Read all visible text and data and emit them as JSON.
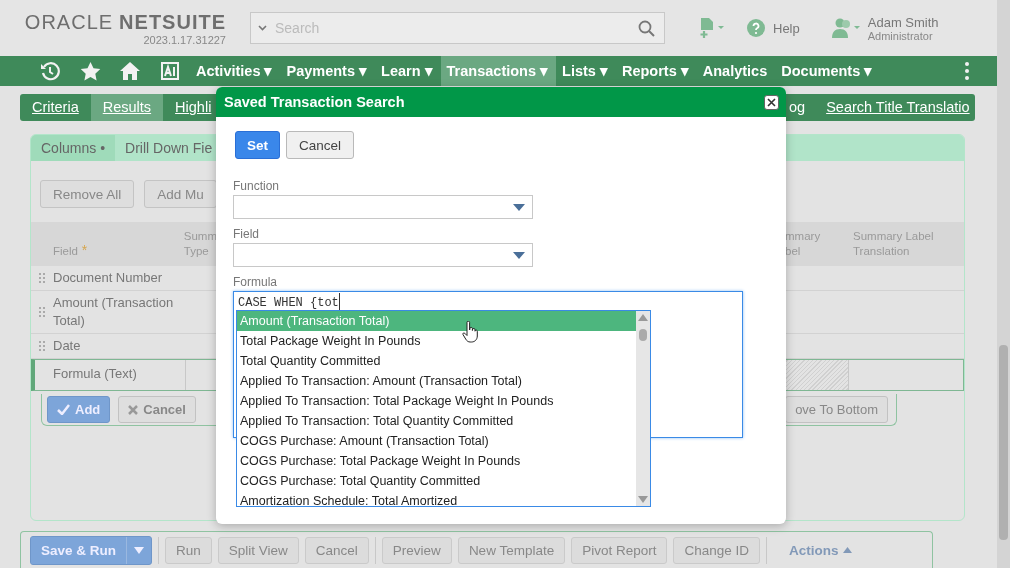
{
  "header": {
    "logo": {
      "oracle": "ORACLE",
      "netsuite": "NETSUITE"
    },
    "version": "2023.1.17.31227",
    "search": {
      "placeholder": "Search"
    },
    "help": "Help",
    "user": {
      "name": "Adam Smith",
      "role": "Administrator"
    }
  },
  "nav": {
    "items": [
      {
        "label": "Activities ▾",
        "selected": false
      },
      {
        "label": "Payments ▾",
        "selected": false
      },
      {
        "label": "Learn ▾",
        "selected": false
      },
      {
        "label": "Transactions ▾",
        "selected": true
      },
      {
        "label": "Lists ▾",
        "selected": false
      },
      {
        "label": "Reports ▾",
        "selected": false
      },
      {
        "label": "Analytics",
        "selected": false
      },
      {
        "label": "Documents ▾",
        "selected": false
      }
    ]
  },
  "subtabs": {
    "left": [
      {
        "label": "Criteria",
        "selected": false
      },
      {
        "label": "Results",
        "selected": true
      },
      {
        "label": "Highli",
        "selected": false
      }
    ],
    "right": [
      {
        "label": "og",
        "selected": false
      },
      {
        "label": "Search Title Translatio",
        "selected": false
      }
    ]
  },
  "panel": {
    "tabs": [
      {
        "label": "Columns •",
        "selected": true
      },
      {
        "label": "Drill Down Fie",
        "selected": false
      }
    ],
    "buttons": [
      "Remove All",
      "Add Mu"
    ],
    "table": {
      "columns_left": [
        {
          "lines": [
            "Field"
          ],
          "marker": "*"
        },
        {
          "lines": [
            "Summ",
            "Type"
          ]
        }
      ],
      "columns_right": [
        {
          "lines": [
            "mmary",
            "bel"
          ]
        },
        {
          "lines": [
            "Summary Label",
            "Translation"
          ]
        }
      ],
      "rows": [
        {
          "field": "Document Number",
          "selected": false
        },
        {
          "field": "Amount (Transaction Total)",
          "selected": false
        },
        {
          "field": "Date",
          "selected": false
        },
        {
          "field": "Formula (Text)",
          "selected": true
        }
      ]
    },
    "row_buttons_left": [
      {
        "label": "Add",
        "kind": "primary"
      },
      {
        "label": "Cancel",
        "kind": "cancel"
      }
    ],
    "row_buttons_right": [
      {
        "label": "ove To Bottom",
        "kind": "plain"
      }
    ]
  },
  "bottom_bar": {
    "buttons": [
      {
        "label": "Save & Run",
        "kind": "split"
      },
      {
        "label": "Run",
        "kind": "plain"
      },
      {
        "label": "Split View",
        "kind": "plain"
      },
      {
        "label": "Cancel",
        "kind": "plain"
      },
      {
        "label": "Preview",
        "kind": "plain"
      },
      {
        "label": "New Template",
        "kind": "plain"
      },
      {
        "label": "Pivot Report",
        "kind": "plain"
      },
      {
        "label": "Change ID",
        "kind": "plain"
      }
    ],
    "actions": "Actions"
  },
  "dialog": {
    "title": "Saved Transaction Search",
    "buttons": [
      {
        "label": "Set",
        "kind": "primary"
      },
      {
        "label": "Cancel",
        "kind": "secondary"
      }
    ],
    "selects": [
      {
        "label": "Function"
      },
      {
        "label": "Field"
      }
    ],
    "formula": {
      "label": "Formula",
      "value": "CASE WHEN {tot",
      "suggestions": [
        {
          "label": "Amount (Transaction Total)",
          "selected": true
        },
        {
          "label": "Total Package Weight In Pounds",
          "selected": false
        },
        {
          "label": "Total Quantity Committed",
          "selected": false
        },
        {
          "label": "Applied To Transaction: Amount (Transaction Total)",
          "selected": false
        },
        {
          "label": "Applied To Transaction: Total Package Weight In Pounds",
          "selected": false
        },
        {
          "label": "Applied To Transaction: Total Quantity Committed",
          "selected": false
        },
        {
          "label": "COGS Purchase: Amount (Transaction Total)",
          "selected": false
        },
        {
          "label": "COGS Purchase: Total Package Weight In Pounds",
          "selected": false
        },
        {
          "label": "COGS Purchase: Total Quantity Committed",
          "selected": false
        },
        {
          "label": "Amortization Schedule: Total Amortized",
          "selected": false
        }
      ]
    }
  }
}
